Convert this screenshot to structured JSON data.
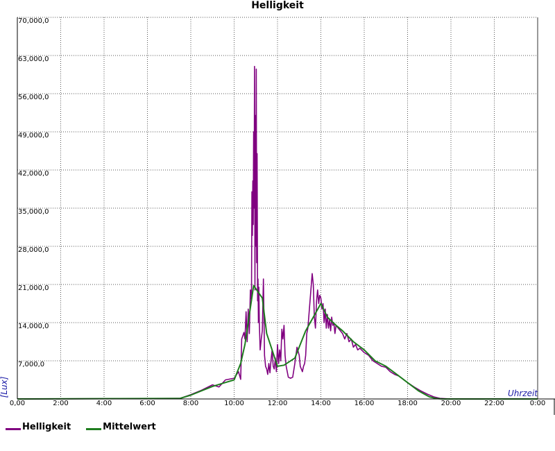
{
  "chart_data": {
    "type": "line",
    "title": "Helligkeit",
    "xlabel": "Uhrzeit",
    "ylabel": "[Lux]",
    "xlim": [
      0,
      24
    ],
    "ylim": [
      0,
      70000
    ],
    "grid": true,
    "legend_position": "bottom-left",
    "x_ticks": [
      "0,00",
      "2:00",
      "4:00",
      "6:00",
      "8:00",
      "10:00",
      "12:00",
      "14:00",
      "16:00",
      "18:00",
      "20:00",
      "22:00",
      "0:00"
    ],
    "y_ticks": [
      "70,000,0",
      "63,000,0",
      "56,000,0",
      "49,000,0",
      "42,000,0",
      "35,000,0",
      "28,000,0",
      "21,000,0",
      "14,000,0",
      "7,000,0"
    ],
    "series": [
      {
        "name": "Helligkeit",
        "color": "#800080",
        "x": [
          0,
          7.5,
          8.0,
          8.5,
          9.0,
          9.3,
          9.6,
          10.0,
          10.2,
          10.3,
          10.35,
          10.45,
          10.5,
          10.55,
          10.6,
          10.65,
          10.7,
          10.75,
          10.8,
          10.82,
          10.84,
          10.86,
          10.88,
          10.9,
          10.92,
          10.94,
          10.96,
          10.98,
          11.0,
          11.02,
          11.04,
          11.06,
          11.08,
          11.1,
          11.12,
          11.14,
          11.16,
          11.2,
          11.25,
          11.3,
          11.35,
          11.4,
          11.45,
          11.5,
          11.55,
          11.6,
          11.65,
          11.7,
          11.75,
          11.8,
          11.85,
          11.9,
          11.95,
          12.0,
          12.05,
          12.1,
          12.15,
          12.2,
          12.25,
          12.3,
          12.35,
          12.4,
          12.5,
          12.6,
          12.7,
          12.8,
          12.9,
          13.0,
          13.05,
          13.1,
          13.15,
          13.2,
          13.25,
          13.3,
          13.35,
          13.4,
          13.5,
          13.6,
          13.65,
          13.7,
          13.75,
          13.8,
          13.85,
          13.9,
          13.95,
          14.0,
          14.05,
          14.1,
          14.15,
          14.2,
          14.25,
          14.3,
          14.35,
          14.4,
          14.45,
          14.5,
          14.55,
          14.6,
          14.65,
          14.7,
          14.8,
          14.9,
          15.0,
          15.1,
          15.2,
          15.3,
          15.4,
          15.5,
          15.6,
          15.7,
          15.8,
          16.0,
          16.2,
          16.4,
          16.6,
          16.8,
          17.0,
          17.2,
          17.4,
          17.6,
          17.8,
          18.0,
          18.3,
          18.6,
          18.9,
          19.2,
          19.5,
          20.0,
          24.0
        ],
        "y": [
          0,
          100,
          800,
          1600,
          2600,
          2200,
          3500,
          3800,
          5000,
          3600,
          11000,
          12200,
          11000,
          16000,
          10500,
          16500,
          12000,
          20000,
          18000,
          38000,
          30000,
          40000,
          32000,
          49000,
          35000,
          61000,
          20000,
          52000,
          28000,
          60500,
          25000,
          45000,
          18000,
          22000,
          14000,
          20500,
          14000,
          9000,
          11000,
          12500,
          22000,
          8000,
          6000,
          5500,
          4500,
          6500,
          4800,
          7000,
          9000,
          6000,
          5500,
          7500,
          5000,
          10000,
          6500,
          9000,
          7000,
          12800,
          11000,
          13500,
          8000,
          6000,
          4000,
          3800,
          4000,
          6500,
          9500,
          8000,
          6000,
          5500,
          5000,
          6000,
          6500,
          8000,
          12000,
          13000,
          18000,
          23000,
          21000,
          15000,
          13000,
          18000,
          20000,
          17500,
          19000,
          18500,
          16500,
          17500,
          14000,
          16500,
          13000,
          15500,
          13000,
          14500,
          12500,
          15000,
          13500,
          14000,
          12000,
          13500,
          13000,
          12500,
          12000,
          11000,
          12000,
          10500,
          11000,
          9500,
          10000,
          9000,
          9300,
          8500,
          8000,
          7000,
          6500,
          6000,
          5800,
          5000,
          4500,
          4200,
          3600,
          3000,
          2200,
          1500,
          900,
          400,
          100,
          0,
          0
        ]
      },
      {
        "name": "Mittelwert",
        "color": "#1e7d1e",
        "x": [
          0,
          7.5,
          8.0,
          8.5,
          9.0,
          9.5,
          10.0,
          10.3,
          10.5,
          10.9,
          11.3,
          11.5,
          12.0,
          12.3,
          12.8,
          13.3,
          14.0,
          14.3,
          14.7,
          15.0,
          15.5,
          16.0,
          16.5,
          17.0,
          17.5,
          18.0,
          18.5,
          19.0,
          19.3,
          19.6,
          20.0,
          24.0
        ],
        "y": [
          0,
          100,
          700,
          1500,
          2300,
          2900,
          3500,
          6500,
          10000,
          20800,
          18500,
          12000,
          6000,
          6200,
          7500,
          12500,
          17500,
          15000,
          13500,
          12500,
          10500,
          9000,
          7000,
          6000,
          4500,
          3000,
          1500,
          400,
          100,
          0,
          0,
          0
        ]
      }
    ]
  }
}
